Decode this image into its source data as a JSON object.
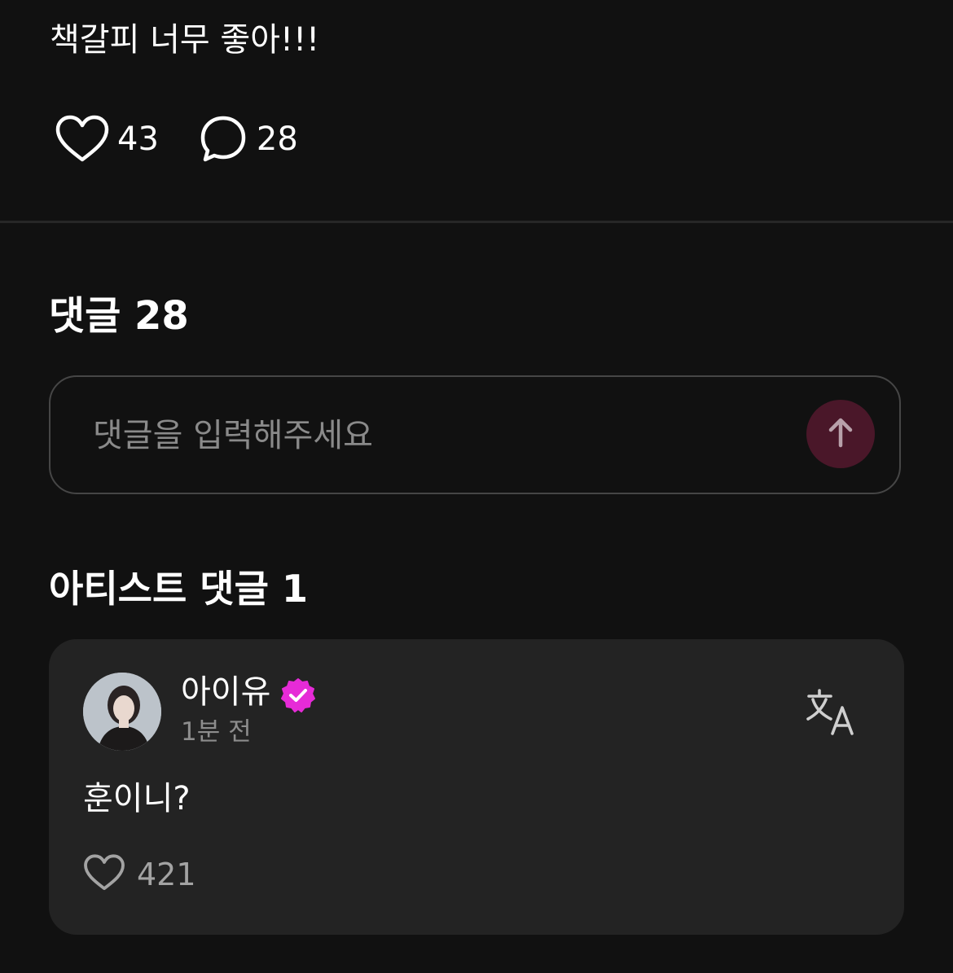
{
  "post": {
    "text": "책갈피 너무 좋아!!!",
    "like_count": "43",
    "comment_count": "28"
  },
  "comments_section": {
    "title": "댓글 28",
    "input_placeholder": "댓글을 입력해주세요",
    "send_icon": "arrow-up-icon"
  },
  "artist_comments": {
    "title": "아티스트 댓글 1",
    "items": [
      {
        "author": "아이유",
        "verified": true,
        "time": "1분 전",
        "text": "훈이니?",
        "like_count": "421"
      }
    ]
  },
  "colors": {
    "background": "#111111",
    "card": "#232323",
    "send_button": "#4a1729",
    "verified_badge": "#e62bd7",
    "muted_text": "#8d8d8d"
  },
  "icons": {
    "like": "heart-icon",
    "comment": "speech-bubble-icon",
    "translate": "translate-icon",
    "verified": "verified-badge-icon"
  }
}
